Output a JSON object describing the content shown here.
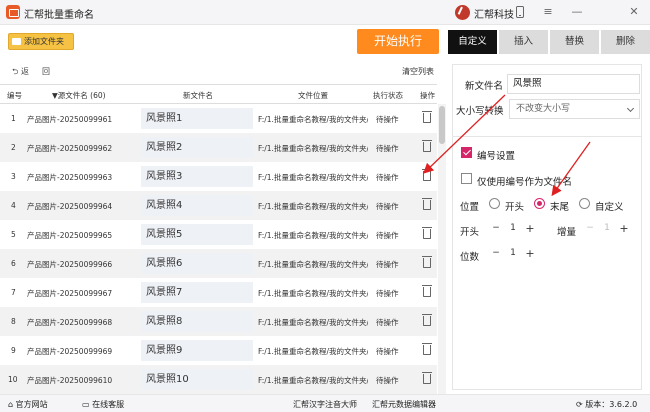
{
  "window": {
    "title": "汇帮批量重命名",
    "brand": "汇帮科技",
    "icons": [
      "app-logo-icon",
      "brand-logo-icon",
      "phone-icon",
      "menu-icon",
      "minimize-icon",
      "close-icon"
    ]
  },
  "toolbar": {
    "add_folder_label": "添加文件夹",
    "start_label": "开始执行"
  },
  "subbar": {
    "undo_label": "返",
    "redo_label": "回",
    "clear_label": "清空列表"
  },
  "table": {
    "headers": {
      "num": "编号",
      "source": "源文件名 (60)",
      "newname": "新文件名",
      "location": "文件位置",
      "status": "执行状态",
      "action": "操作"
    },
    "rows": [
      {
        "num": "1",
        "source": "产品图片-20250099961",
        "newname": "风景照1",
        "location": "F:/1.批量重命名教程/我的文件夹/产",
        "status": "待操作"
      },
      {
        "num": "2",
        "source": "产品图片-20250099962",
        "newname": "风景照2",
        "location": "F:/1.批量重命名教程/我的文件夹/产",
        "status": "待操作"
      },
      {
        "num": "3",
        "source": "产品图片-20250099963",
        "newname": "风景照3",
        "location": "F:/1.批量重命名教程/我的文件夹/产",
        "status": "待操作"
      },
      {
        "num": "4",
        "source": "产品图片-20250099964",
        "newname": "风景照4",
        "location": "F:/1.批量重命名教程/我的文件夹/产",
        "status": "待操作"
      },
      {
        "num": "5",
        "source": "产品图片-20250099965",
        "newname": "风景照5",
        "location": "F:/1.批量重命名教程/我的文件夹/产",
        "status": "待操作"
      },
      {
        "num": "6",
        "source": "产品图片-20250099966",
        "newname": "风景照6",
        "location": "F:/1.批量重命名教程/我的文件夹/产",
        "status": "待操作"
      },
      {
        "num": "7",
        "source": "产品图片-20250099967",
        "newname": "风景照7",
        "location": "F:/1.批量重命名教程/我的文件夹/产",
        "status": "待操作"
      },
      {
        "num": "8",
        "source": "产品图片-20250099968",
        "newname": "风景照8",
        "location": "F:/1.批量重命名教程/我的文件夹/产",
        "status": "待操作"
      },
      {
        "num": "9",
        "source": "产品图片-20250099969",
        "newname": "风景照9",
        "location": "F:/1.批量重命名教程/我的文件夹/产",
        "status": "待操作"
      },
      {
        "num": "10",
        "source": "产品图片-20250099610",
        "newname": "风景照10",
        "location": "F:/1.批量重命名教程/我的文件夹/产",
        "status": "待操作"
      }
    ]
  },
  "tabs": [
    "自定义",
    "插入",
    "替换",
    "删除"
  ],
  "panel": {
    "newname_label": "新文件名",
    "newname_value": "风景照",
    "case_label": "大小写转换",
    "case_value": "不改变大小写",
    "numbering_label": "编号设置",
    "numbering_checked": true,
    "only_number_label": "仅使用编号作为文件名",
    "only_number_checked": false,
    "position_label": "位置",
    "position_options": [
      "开头",
      "末尾",
      "自定义"
    ],
    "position_selected": "末尾",
    "start_label": "开头",
    "start_value": "1",
    "increment_label": "增量",
    "increment_value": "1",
    "digits_label": "位数",
    "digits_value": "1",
    "minus": "−",
    "plus": "+"
  },
  "statusbar": {
    "website": "官方网站",
    "support": "在线客服",
    "pinyin": "汇帮汉字注音大师",
    "metadata": "汇帮元数据编辑器",
    "version_label": "版本：",
    "version_value": "3.6.2.0"
  },
  "colors": {
    "accent": "#d6266a",
    "start_button": "#ff8a1e",
    "add_folder": "#f6c244",
    "tab_active": "#111111"
  }
}
